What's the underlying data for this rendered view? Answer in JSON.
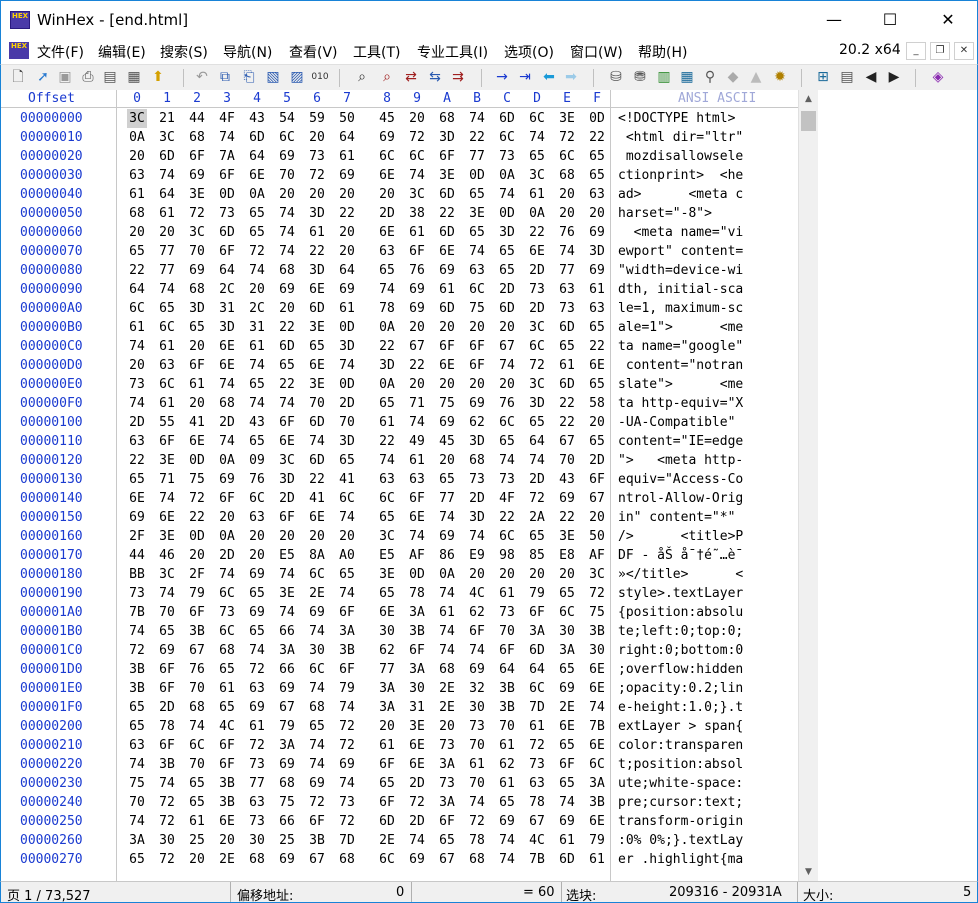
{
  "window": {
    "title": "WinHex - [end.html]",
    "minimize": "—",
    "maximize": "☐",
    "close": "✕",
    "app_icon_text": "HEX"
  },
  "menu": {
    "items": [
      "文件(F)",
      "编辑(E)",
      "搜索(S)",
      "导航(N)",
      "查看(V)",
      "工具(T)",
      "专业工具(I)",
      "选项(O)",
      "窗口(W)",
      "帮助(H)"
    ],
    "version": "20.2 x64"
  },
  "header": {
    "offset_label": "Offset",
    "columns": [
      "0",
      "1",
      "2",
      "3",
      "4",
      "5",
      "6",
      "7",
      "8",
      "9",
      "A",
      "B",
      "C",
      "D",
      "E",
      "F"
    ],
    "ansi_label": "ANSI ASCII"
  },
  "rows": [
    {
      "offset": "00000000",
      "bytes": [
        "3C",
        "21",
        "44",
        "4F",
        "43",
        "54",
        "59",
        "50",
        "45",
        "20",
        "68",
        "74",
        "6D",
        "6C",
        "3E",
        "0D"
      ],
      "ascii": "<!DOCTYPE html>"
    },
    {
      "offset": "00000010",
      "bytes": [
        "0A",
        "3C",
        "68",
        "74",
        "6D",
        "6C",
        "20",
        "64",
        "69",
        "72",
        "3D",
        "22",
        "6C",
        "74",
        "72",
        "22"
      ],
      "ascii": " <html dir=\"ltr\""
    },
    {
      "offset": "00000020",
      "bytes": [
        "20",
        "6D",
        "6F",
        "7A",
        "64",
        "69",
        "73",
        "61",
        "6C",
        "6C",
        "6F",
        "77",
        "73",
        "65",
        "6C",
        "65"
      ],
      "ascii": " mozdisallowsele"
    },
    {
      "offset": "00000030",
      "bytes": [
        "63",
        "74",
        "69",
        "6F",
        "6E",
        "70",
        "72",
        "69",
        "6E",
        "74",
        "3E",
        "0D",
        "0A",
        "3C",
        "68",
        "65"
      ],
      "ascii": "ctionprint>  <he"
    },
    {
      "offset": "00000040",
      "bytes": [
        "61",
        "64",
        "3E",
        "0D",
        "0A",
        "20",
        "20",
        "20",
        "20",
        "3C",
        "6D",
        "65",
        "74",
        "61",
        "20",
        "63"
      ],
      "ascii": "ad>      <meta c"
    },
    {
      "offset": "00000050",
      "bytes": [
        "68",
        "61",
        "72",
        "73",
        "65",
        "74",
        "3D",
        "22",
        "2D",
        "38",
        "22",
        "3E",
        "0D",
        "0A",
        "20",
        "20"
      ],
      "ascii": "harset=\"-8\">    "
    },
    {
      "offset": "00000060",
      "bytes": [
        "20",
        "20",
        "3C",
        "6D",
        "65",
        "74",
        "61",
        "20",
        "6E",
        "61",
        "6D",
        "65",
        "3D",
        "22",
        "76",
        "69"
      ],
      "ascii": "  <meta name=\"vi"
    },
    {
      "offset": "00000070",
      "bytes": [
        "65",
        "77",
        "70",
        "6F",
        "72",
        "74",
        "22",
        "20",
        "63",
        "6F",
        "6E",
        "74",
        "65",
        "6E",
        "74",
        "3D"
      ],
      "ascii": "ewport\" content="
    },
    {
      "offset": "00000080",
      "bytes": [
        "22",
        "77",
        "69",
        "64",
        "74",
        "68",
        "3D",
        "64",
        "65",
        "76",
        "69",
        "63",
        "65",
        "2D",
        "77",
        "69"
      ],
      "ascii": "\"width=device-wi"
    },
    {
      "offset": "00000090",
      "bytes": [
        "64",
        "74",
        "68",
        "2C",
        "20",
        "69",
        "6E",
        "69",
        "74",
        "69",
        "61",
        "6C",
        "2D",
        "73",
        "63",
        "61"
      ],
      "ascii": "dth, initial-sca"
    },
    {
      "offset": "000000A0",
      "bytes": [
        "6C",
        "65",
        "3D",
        "31",
        "2C",
        "20",
        "6D",
        "61",
        "78",
        "69",
        "6D",
        "75",
        "6D",
        "2D",
        "73",
        "63"
      ],
      "ascii": "le=1, maximum-sc"
    },
    {
      "offset": "000000B0",
      "bytes": [
        "61",
        "6C",
        "65",
        "3D",
        "31",
        "22",
        "3E",
        "0D",
        "0A",
        "20",
        "20",
        "20",
        "20",
        "3C",
        "6D",
        "65"
      ],
      "ascii": "ale=1\">      <me"
    },
    {
      "offset": "000000C0",
      "bytes": [
        "74",
        "61",
        "20",
        "6E",
        "61",
        "6D",
        "65",
        "3D",
        "22",
        "67",
        "6F",
        "6F",
        "67",
        "6C",
        "65",
        "22"
      ],
      "ascii": "ta name=\"google\""
    },
    {
      "offset": "000000D0",
      "bytes": [
        "20",
        "63",
        "6F",
        "6E",
        "74",
        "65",
        "6E",
        "74",
        "3D",
        "22",
        "6E",
        "6F",
        "74",
        "72",
        "61",
        "6E"
      ],
      "ascii": " content=\"notran"
    },
    {
      "offset": "000000E0",
      "bytes": [
        "73",
        "6C",
        "61",
        "74",
        "65",
        "22",
        "3E",
        "0D",
        "0A",
        "20",
        "20",
        "20",
        "20",
        "3C",
        "6D",
        "65"
      ],
      "ascii": "slate\">      <me"
    },
    {
      "offset": "000000F0",
      "bytes": [
        "74",
        "61",
        "20",
        "68",
        "74",
        "74",
        "70",
        "2D",
        "65",
        "71",
        "75",
        "69",
        "76",
        "3D",
        "22",
        "58"
      ],
      "ascii": "ta http-equiv=\"X"
    },
    {
      "offset": "00000100",
      "bytes": [
        "2D",
        "55",
        "41",
        "2D",
        "43",
        "6F",
        "6D",
        "70",
        "61",
        "74",
        "69",
        "62",
        "6C",
        "65",
        "22",
        "20"
      ],
      "ascii": "-UA-Compatible\" "
    },
    {
      "offset": "00000110",
      "bytes": [
        "63",
        "6F",
        "6E",
        "74",
        "65",
        "6E",
        "74",
        "3D",
        "22",
        "49",
        "45",
        "3D",
        "65",
        "64",
        "67",
        "65"
      ],
      "ascii": "content=\"IE=edge"
    },
    {
      "offset": "00000120",
      "bytes": [
        "22",
        "3E",
        "0D",
        "0A",
        "09",
        "3C",
        "6D",
        "65",
        "74",
        "61",
        "20",
        "68",
        "74",
        "74",
        "70",
        "2D"
      ],
      "ascii": "\">   <meta http-"
    },
    {
      "offset": "00000130",
      "bytes": [
        "65",
        "71",
        "75",
        "69",
        "76",
        "3D",
        "22",
        "41",
        "63",
        "63",
        "65",
        "73",
        "73",
        "2D",
        "43",
        "6F"
      ],
      "ascii": "equiv=\"Access-Co"
    },
    {
      "offset": "00000140",
      "bytes": [
        "6E",
        "74",
        "72",
        "6F",
        "6C",
        "2D",
        "41",
        "6C",
        "6C",
        "6F",
        "77",
        "2D",
        "4F",
        "72",
        "69",
        "67"
      ],
      "ascii": "ntrol-Allow-Orig"
    },
    {
      "offset": "00000150",
      "bytes": [
        "69",
        "6E",
        "22",
        "20",
        "63",
        "6F",
        "6E",
        "74",
        "65",
        "6E",
        "74",
        "3D",
        "22",
        "2A",
        "22",
        "20"
      ],
      "ascii": "in\" content=\"*\" "
    },
    {
      "offset": "00000160",
      "bytes": [
        "2F",
        "3E",
        "0D",
        "0A",
        "20",
        "20",
        "20",
        "20",
        "3C",
        "74",
        "69",
        "74",
        "6C",
        "65",
        "3E",
        "50"
      ],
      "ascii": "/>      <title>P"
    },
    {
      "offset": "00000170",
      "bytes": [
        "44",
        "46",
        "20",
        "2D",
        "20",
        "E5",
        "8A",
        "A0",
        "E5",
        "AF",
        "86",
        "E9",
        "98",
        "85",
        "E8",
        "AF"
      ],
      "ascii": "DF - åŠ å¯†é˜…è¯"
    },
    {
      "offset": "00000180",
      "bytes": [
        "BB",
        "3C",
        "2F",
        "74",
        "69",
        "74",
        "6C",
        "65",
        "3E",
        "0D",
        "0A",
        "20",
        "20",
        "20",
        "20",
        "3C"
      ],
      "ascii": "»</title>      <"
    },
    {
      "offset": "00000190",
      "bytes": [
        "73",
        "74",
        "79",
        "6C",
        "65",
        "3E",
        "2E",
        "74",
        "65",
        "78",
        "74",
        "4C",
        "61",
        "79",
        "65",
        "72"
      ],
      "ascii": "style>.textLayer"
    },
    {
      "offset": "000001A0",
      "bytes": [
        "7B",
        "70",
        "6F",
        "73",
        "69",
        "74",
        "69",
        "6F",
        "6E",
        "3A",
        "61",
        "62",
        "73",
        "6F",
        "6C",
        "75"
      ],
      "ascii": "{position:absolu"
    },
    {
      "offset": "000001B0",
      "bytes": [
        "74",
        "65",
        "3B",
        "6C",
        "65",
        "66",
        "74",
        "3A",
        "30",
        "3B",
        "74",
        "6F",
        "70",
        "3A",
        "30",
        "3B"
      ],
      "ascii": "te;left:0;top:0;"
    },
    {
      "offset": "000001C0",
      "bytes": [
        "72",
        "69",
        "67",
        "68",
        "74",
        "3A",
        "30",
        "3B",
        "62",
        "6F",
        "74",
        "74",
        "6F",
        "6D",
        "3A",
        "30"
      ],
      "ascii": "right:0;bottom:0"
    },
    {
      "offset": "000001D0",
      "bytes": [
        "3B",
        "6F",
        "76",
        "65",
        "72",
        "66",
        "6C",
        "6F",
        "77",
        "3A",
        "68",
        "69",
        "64",
        "64",
        "65",
        "6E"
      ],
      "ascii": ";overflow:hidden"
    },
    {
      "offset": "000001E0",
      "bytes": [
        "3B",
        "6F",
        "70",
        "61",
        "63",
        "69",
        "74",
        "79",
        "3A",
        "30",
        "2E",
        "32",
        "3B",
        "6C",
        "69",
        "6E"
      ],
      "ascii": ";opacity:0.2;lin"
    },
    {
      "offset": "000001F0",
      "bytes": [
        "65",
        "2D",
        "68",
        "65",
        "69",
        "67",
        "68",
        "74",
        "3A",
        "31",
        "2E",
        "30",
        "3B",
        "7D",
        "2E",
        "74"
      ],
      "ascii": "e-height:1.0;}.t"
    },
    {
      "offset": "00000200",
      "bytes": [
        "65",
        "78",
        "74",
        "4C",
        "61",
        "79",
        "65",
        "72",
        "20",
        "3E",
        "20",
        "73",
        "70",
        "61",
        "6E",
        "7B"
      ],
      "ascii": "extLayer > span{"
    },
    {
      "offset": "00000210",
      "bytes": [
        "63",
        "6F",
        "6C",
        "6F",
        "72",
        "3A",
        "74",
        "72",
        "61",
        "6E",
        "73",
        "70",
        "61",
        "72",
        "65",
        "6E"
      ],
      "ascii": "color:transparen"
    },
    {
      "offset": "00000220",
      "bytes": [
        "74",
        "3B",
        "70",
        "6F",
        "73",
        "69",
        "74",
        "69",
        "6F",
        "6E",
        "3A",
        "61",
        "62",
        "73",
        "6F",
        "6C"
      ],
      "ascii": "t;position:absol"
    },
    {
      "offset": "00000230",
      "bytes": [
        "75",
        "74",
        "65",
        "3B",
        "77",
        "68",
        "69",
        "74",
        "65",
        "2D",
        "73",
        "70",
        "61",
        "63",
        "65",
        "3A"
      ],
      "ascii": "ute;white-space:"
    },
    {
      "offset": "00000240",
      "bytes": [
        "70",
        "72",
        "65",
        "3B",
        "63",
        "75",
        "72",
        "73",
        "6F",
        "72",
        "3A",
        "74",
        "65",
        "78",
        "74",
        "3B"
      ],
      "ascii": "pre;cursor:text;"
    },
    {
      "offset": "00000250",
      "bytes": [
        "74",
        "72",
        "61",
        "6E",
        "73",
        "66",
        "6F",
        "72",
        "6D",
        "2D",
        "6F",
        "72",
        "69",
        "67",
        "69",
        "6E"
      ],
      "ascii": "transform-origin"
    },
    {
      "offset": "00000260",
      "bytes": [
        "3A",
        "30",
        "25",
        "20",
        "30",
        "25",
        "3B",
        "7D",
        "2E",
        "74",
        "65",
        "78",
        "74",
        "4C",
        "61",
        "79"
      ],
      "ascii": ":0% 0%;}.textLay"
    },
    {
      "offset": "00000270",
      "bytes": [
        "65",
        "72",
        "20",
        "2E",
        "68",
        "69",
        "67",
        "68",
        "6C",
        "69",
        "67",
        "68",
        "74",
        "7B",
        "6D",
        "61"
      ],
      "ascii": "er .highlight{ma"
    }
  ],
  "status": {
    "page": "页 1 / 73,527",
    "offset_label": "偏移地址:",
    "offset_value": "0",
    "value": "= 60",
    "block_label": "选块:",
    "block_value": "209316 - 20931A",
    "size_label": "大小:",
    "size_value": "5"
  },
  "toolbar_icons": [
    "new-file-icon",
    "open-file-icon",
    "save-icon",
    "print-icon",
    "properties-icon",
    "disk-icon",
    "export-icon",
    "undo-icon",
    "copy-icon",
    "paste-icon",
    "paste-block-icon",
    "copy-hex-icon",
    "fill-icon",
    "find-icon",
    "find-hex-icon",
    "replace-icon",
    "replace-hex-icon",
    "find-next-icon",
    "goto-offset-icon",
    "goto-icon",
    "back-icon",
    "forward-icon",
    "open-disk-icon",
    "disk-editor-icon",
    "ram-icon",
    "calc-icon",
    "search-icon",
    "hash-icon",
    "compare-icon",
    "toolbox-icon",
    "options-icon",
    "table-icon",
    "prev-icon",
    "next-icon",
    "help-book-icon"
  ]
}
